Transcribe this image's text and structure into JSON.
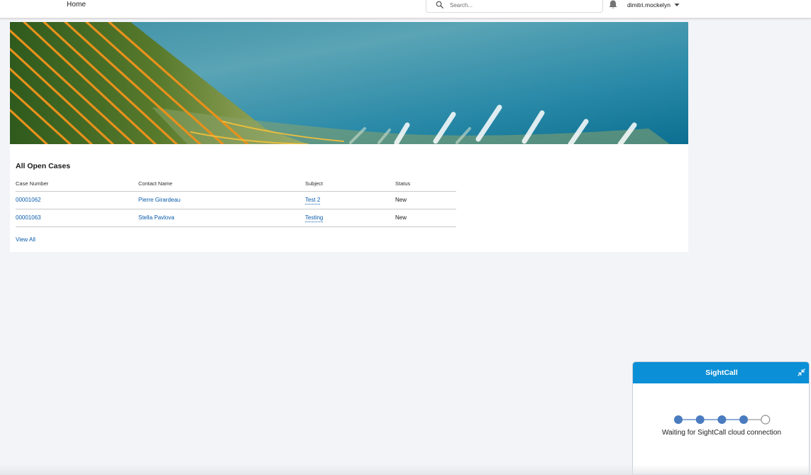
{
  "header": {
    "home_label": "Home",
    "search_placeholder": "Search...",
    "user_name": "dimitri.mockelyn"
  },
  "cases": {
    "title": "All Open Cases",
    "columns": [
      "Case Number",
      "Contact Name",
      "Subject",
      "Status"
    ],
    "rows": [
      {
        "case_number": "00001062",
        "contact": "Pierre Girardeau",
        "subject": "Test 2",
        "status": "New"
      },
      {
        "case_number": "00001063",
        "contact": "Stella Pavlova",
        "subject": "Testing",
        "status": "New"
      }
    ],
    "view_all_label": "View All"
  },
  "sightcall": {
    "title": "SightCall",
    "status": "Waiting for SightCall cloud connection",
    "steps_total": 5,
    "steps_done": 4
  },
  "colors": {
    "link": "#0b5cab",
    "sightcall_header": "#0b8fd6",
    "step_filled": "#4a7bbf"
  },
  "icons": [
    "search-icon",
    "bell-icon",
    "chevron-down-icon",
    "collapse-icon"
  ]
}
